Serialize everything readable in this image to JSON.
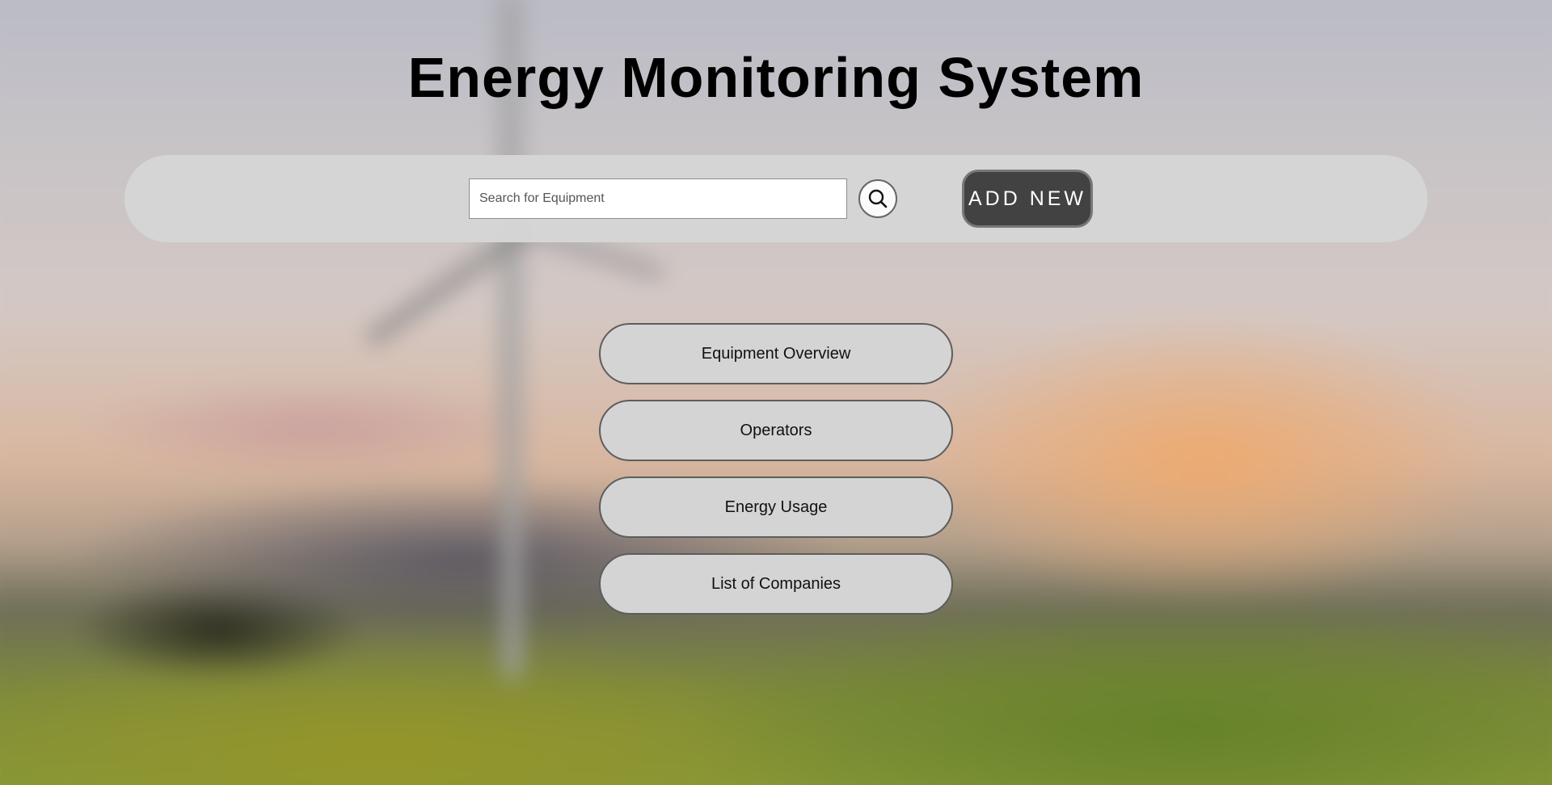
{
  "page": {
    "title": "Energy Monitoring System"
  },
  "toolbar": {
    "search_placeholder": "Search for Equipment",
    "search_value": "",
    "search_icon": "search-icon",
    "add_new_label": "ADD NEW"
  },
  "nav": {
    "items": [
      {
        "label": "Equipment Overview"
      },
      {
        "label": "Operators"
      },
      {
        "label": "Energy Usage"
      },
      {
        "label": "List of Companies"
      }
    ]
  },
  "colors": {
    "toolbar_bg": "#d6d6d6",
    "add_new_bg": "#424242",
    "nav_button_bg": "#d4d4d4",
    "nav_button_border": "#5d5d5d"
  }
}
